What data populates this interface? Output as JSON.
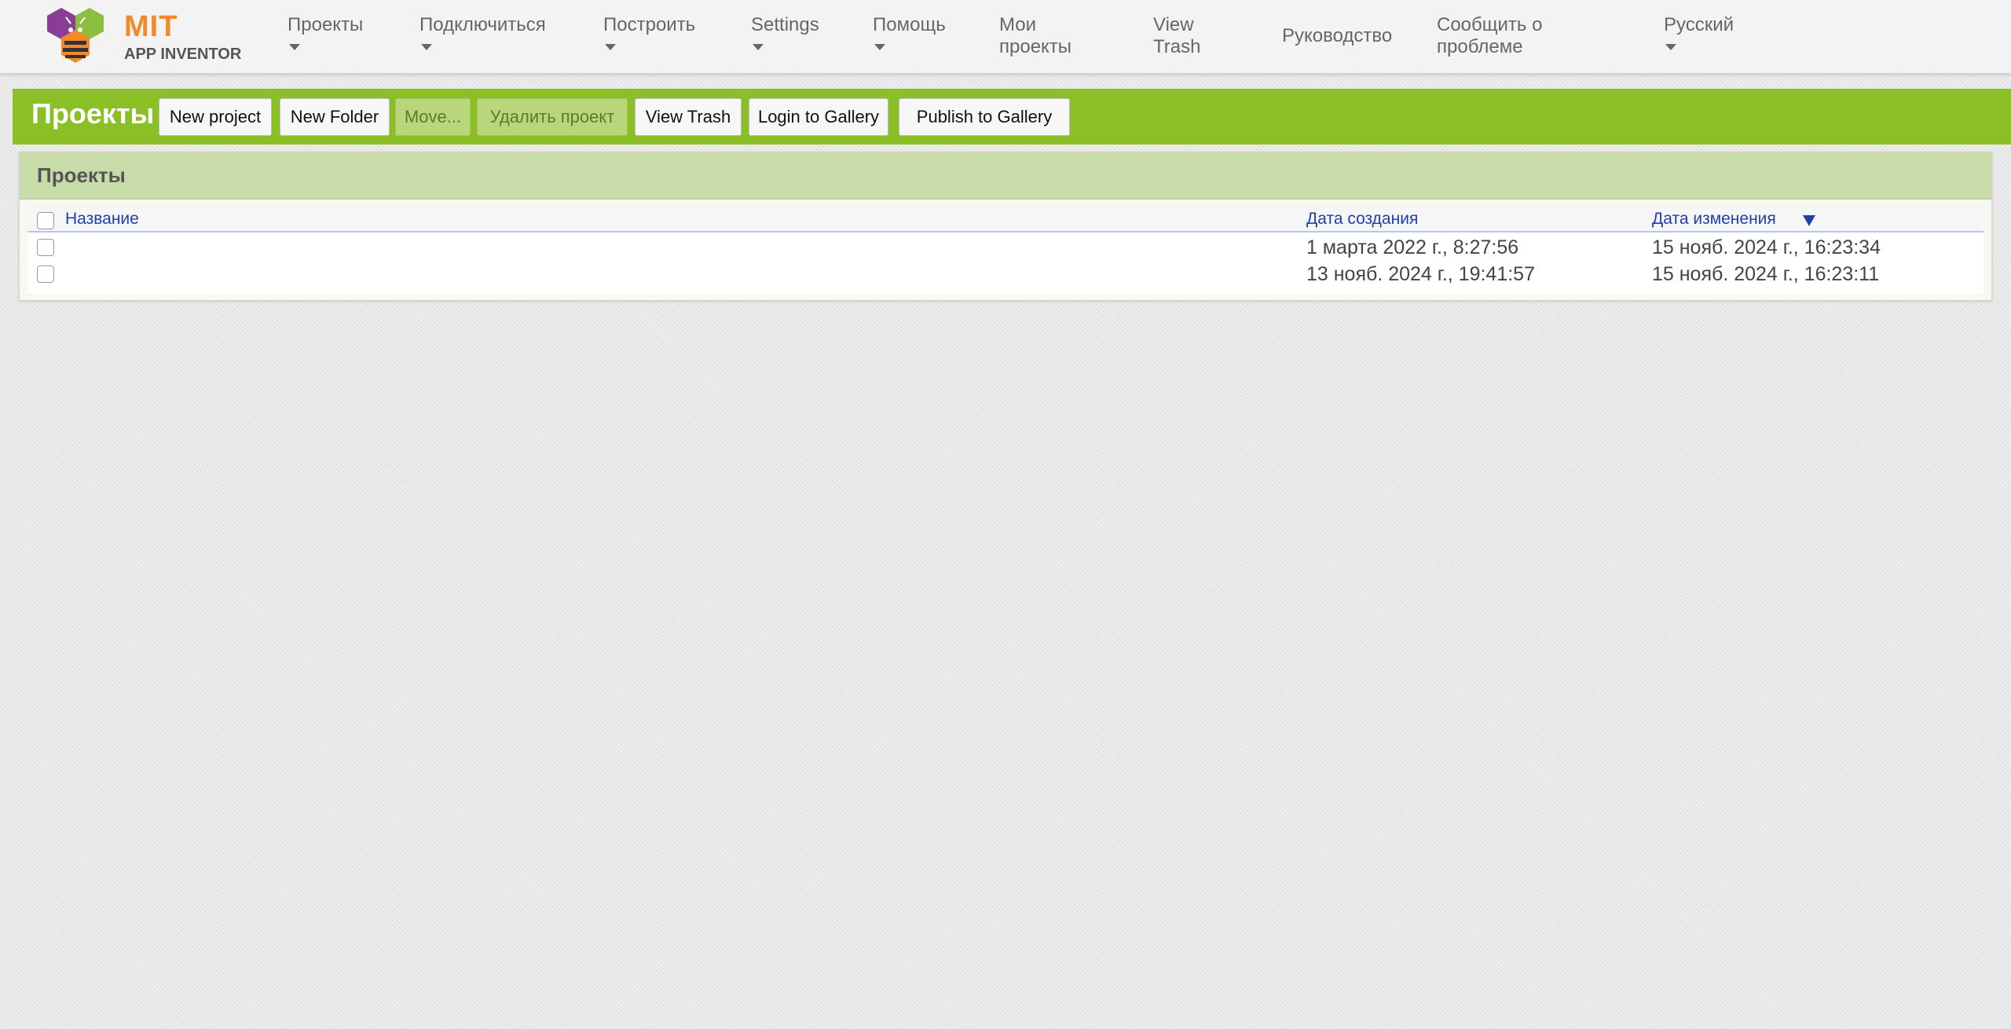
{
  "logo": {
    "mit": "MIT",
    "sub": "APP INVENTOR"
  },
  "nav": {
    "projects": "Проекты",
    "connect": "Подключиться",
    "build": "Построить",
    "settings": "Settings",
    "help": "Помощь",
    "my_projects_1": "Мои",
    "my_projects_2": "проекты",
    "view_trash_1": "View",
    "view_trash_2": "Trash",
    "guide": "Руководство",
    "report_1": "Сообщить о",
    "report_2": "проблеме",
    "language": "Русский"
  },
  "toolbar": {
    "title": "Проекты",
    "new_project": "New project",
    "new_folder": "New Folder",
    "move": "Move...",
    "delete_project": "Удалить проект",
    "view_trash": "View Trash",
    "login_gallery": "Login to Gallery",
    "publish_gallery": "Publish to Gallery"
  },
  "panel": {
    "title": "Проекты",
    "columns": {
      "name": "Название",
      "created": "Дата создания",
      "modified": "Дата изменения"
    },
    "rows": [
      {
        "name": "",
        "created": "1 марта 2022 г., 8:27:56",
        "modified": "15 нояб. 2024 г., 16:23:34"
      },
      {
        "name": "",
        "created": "13 нояб. 2024 г., 19:41:57",
        "modified": "15 нояб. 2024 г., 16:23:11"
      }
    ]
  },
  "colors": {
    "toolbar_green": "#8bbf26",
    "panel_header": "#c8dca9",
    "link_blue": "#1f3fae",
    "logo_orange": "#f08a2b"
  }
}
